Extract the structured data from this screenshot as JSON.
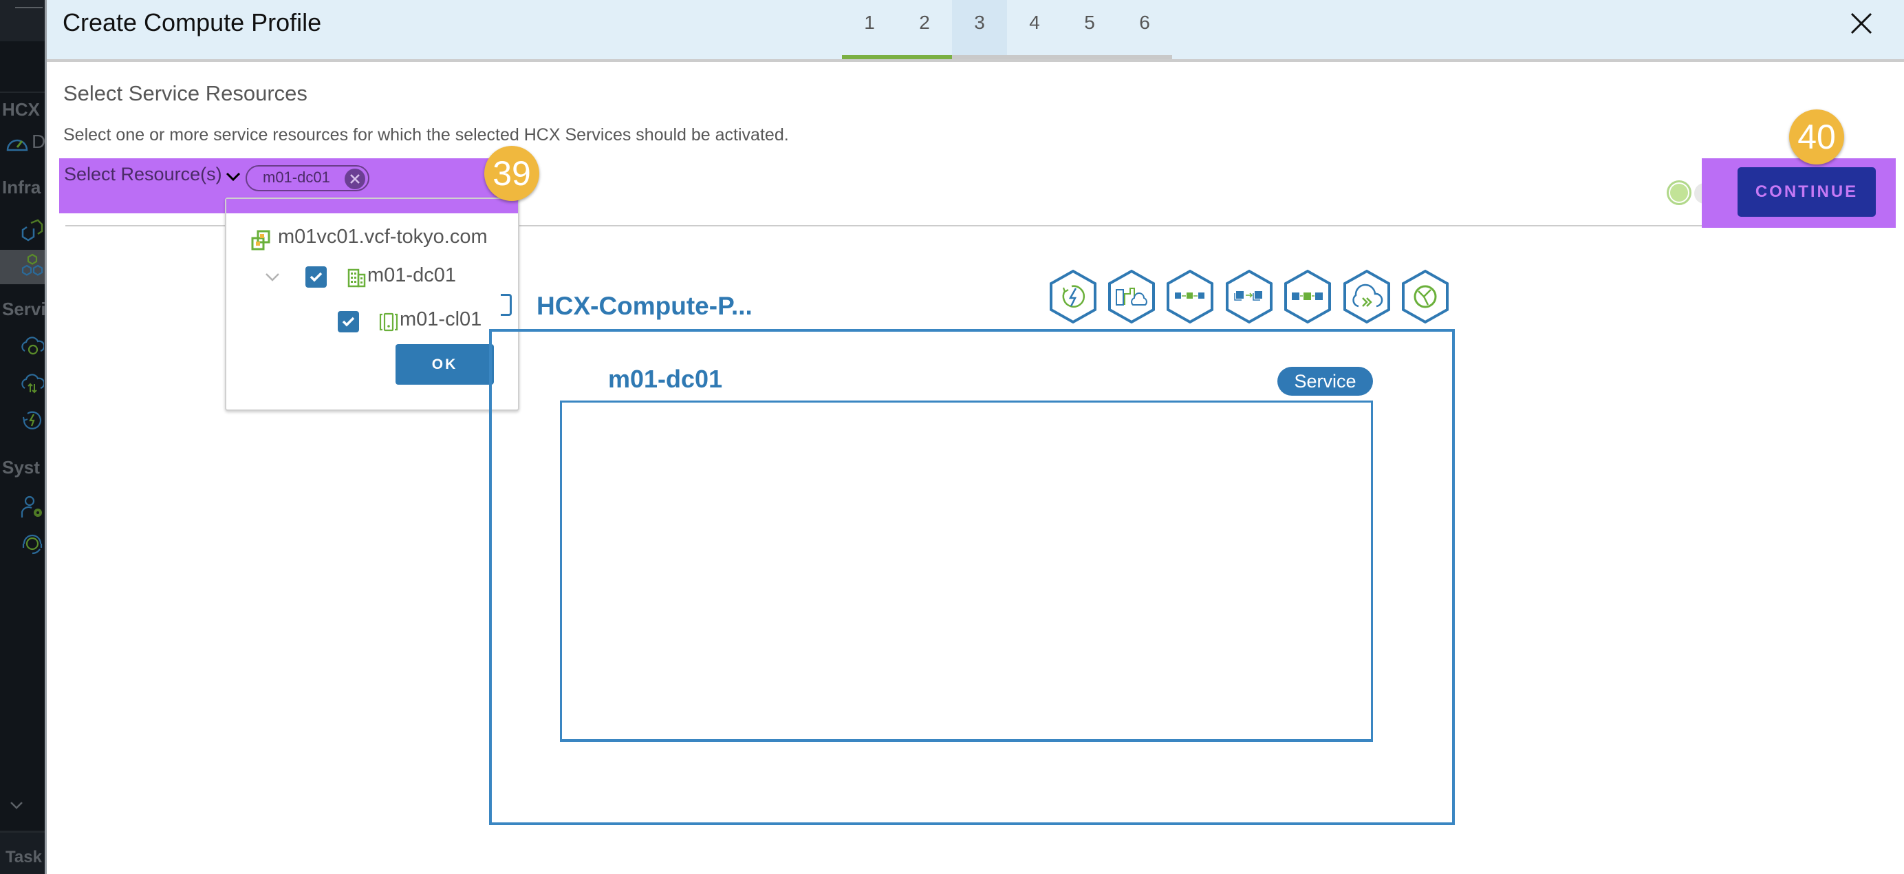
{
  "sidebar": {
    "sections": [
      "HCX",
      "Infra",
      "Servi",
      "Syst"
    ],
    "items": [
      {
        "label": "D",
        "icon": "dashboard-gauge-icon"
      },
      {
        "icon": "site-pairing-icon"
      },
      {
        "icon": "interconnect-icon",
        "selected": true
      },
      {
        "icon": "migration-cloud-icon"
      },
      {
        "icon": "network-extension-icon"
      },
      {
        "icon": "disaster-recovery-icon"
      },
      {
        "icon": "admin-settings-icon"
      },
      {
        "icon": "support-icon"
      }
    ],
    "footer_label": "Task"
  },
  "wizard": {
    "title": "Create Compute Profile",
    "steps": [
      "1",
      "2",
      "3",
      "4",
      "5",
      "6"
    ],
    "active_step": 3,
    "completed_steps": 2
  },
  "content": {
    "section_title": "Select Service Resources",
    "description": "Select one or more service resources for which the selected HCX Services should be activated.",
    "select_label": "Select Resource(s)",
    "selected_chip": "m01-dc01",
    "continue_label": "CONTINUE"
  },
  "dropdown": {
    "tree": [
      {
        "label": "m01vc01.vcf-tokyo.com",
        "icon": "vcenter-icon",
        "level": 0
      },
      {
        "label": "m01-dc01",
        "icon": "datacenter-icon",
        "level": 1,
        "checked": true,
        "expanded": true
      },
      {
        "label": "m01-cl01",
        "icon": "cluster-icon",
        "level": 2,
        "checked": true
      }
    ],
    "ok_label": "OK"
  },
  "annotations": {
    "step_39": "39",
    "step_40": "40"
  },
  "diagram": {
    "profile_name": "HCX-Compute-P...",
    "services": [
      "replication-assisted-vmotion-icon",
      "hybrid-interconnect-icon",
      "bulk-migration-icon",
      "vmotion-migration-icon",
      "replication-icon",
      "network-extension-icon",
      "wan-optimization-icon"
    ],
    "datacenter_label": "m01-dc01",
    "badge_label": "Service"
  },
  "colors": {
    "accent_blue": "#2f79b3",
    "progress_green": "#7bb043",
    "overlay_purple": "#bb6ef5",
    "annotation_gold": "#f0b83e",
    "continue_navy": "#22309b"
  }
}
